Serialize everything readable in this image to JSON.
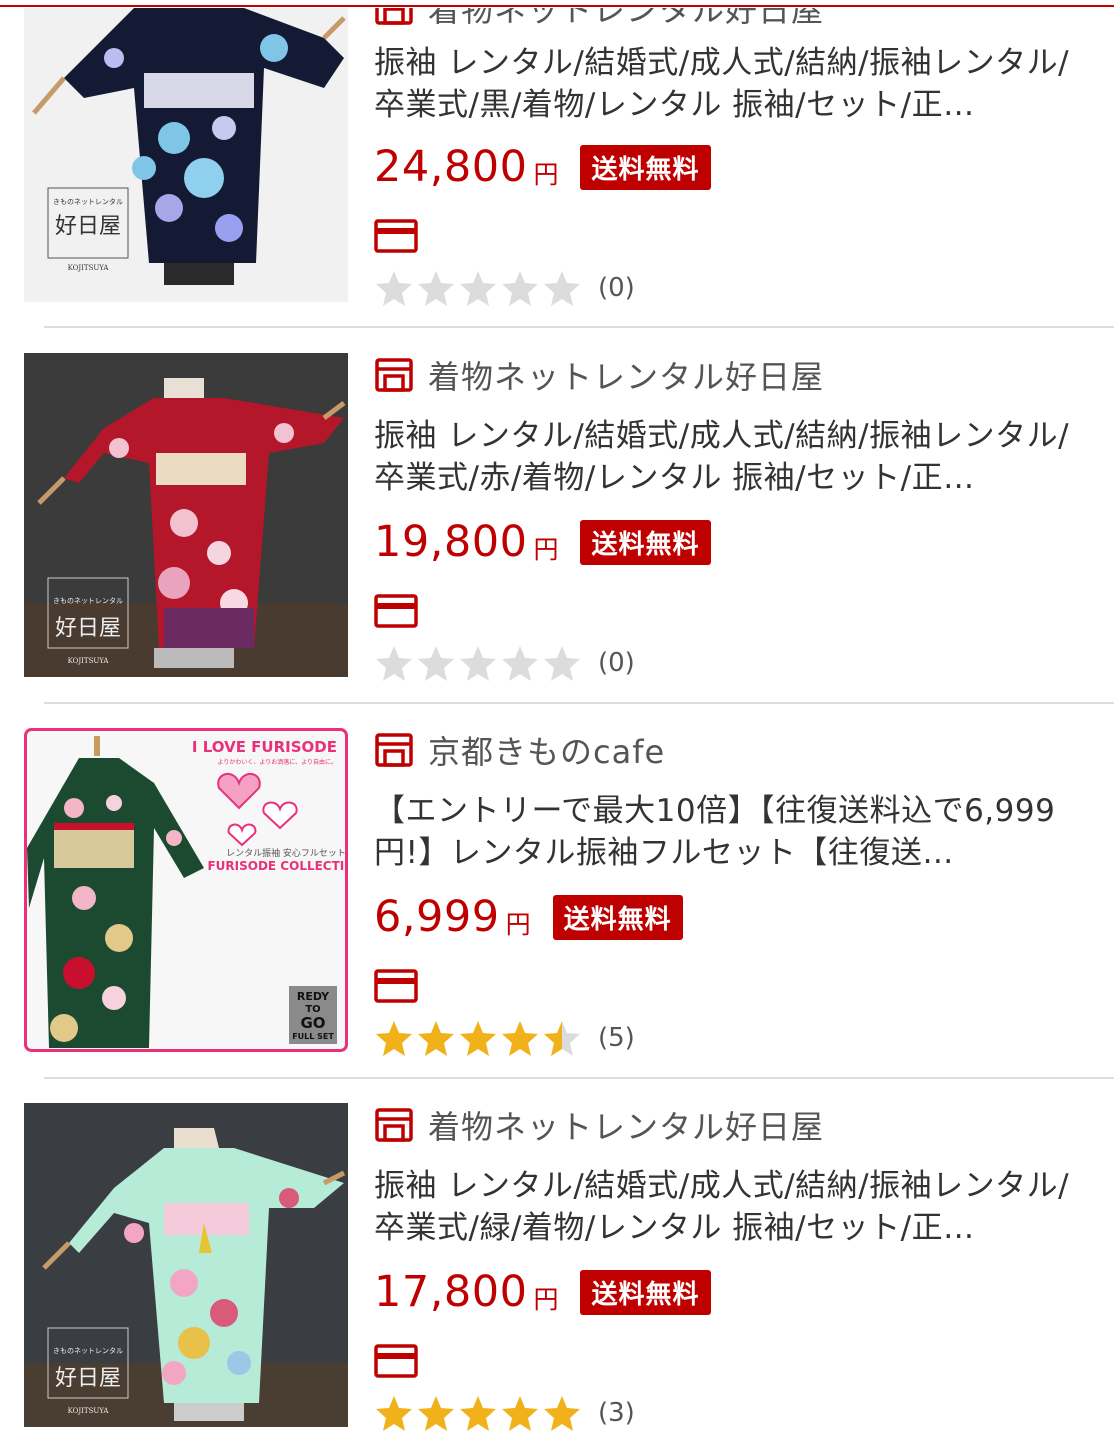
{
  "colors": {
    "accent": "#bf0000",
    "star_on": "#f0b11a",
    "star_off": "#dcdcdc"
  },
  "items": [
    {
      "shop": "着物ネットレンタル好日屋",
      "title": "振袖 レンタル/結婚式/成人式/結納/振袖レンタル/卒業式/黒/着物/レンタル 振袖/セット/正…",
      "price": "24,800",
      "yen": "円",
      "badge": "送料無料",
      "rating": 0,
      "review_count": "(0)",
      "thumb_brand_small": "きものネットレンタル",
      "thumb_brand": "好日屋",
      "thumb_brand_en": "KOJITSUYA",
      "icons": {
        "shop": "shop-icon",
        "card": "credit-card-icon"
      }
    },
    {
      "shop": "着物ネットレンタル好日屋",
      "title": "振袖 レンタル/結婚式/成人式/結納/振袖レンタル/卒業式/赤/着物/レンタル 振袖/セット/正…",
      "price": "19,800",
      "yen": "円",
      "badge": "送料無料",
      "rating": 0,
      "review_count": "(0)",
      "thumb_brand_small": "きものネットレンタル",
      "thumb_brand": "好日屋",
      "thumb_brand_en": "KOJITSUYA",
      "icons": {
        "shop": "shop-icon",
        "card": "credit-card-icon"
      }
    },
    {
      "shop": "京都きものcafe",
      "title": "【エントリーで最大10倍】【往復送料込で6,999円!】レンタル振袖フルセット【往復送…",
      "price": "6,999",
      "yen": "円",
      "badge": "送料無料",
      "rating": 4.5,
      "review_count": "(5)",
      "thumb_heading": "I LOVE FURISODE",
      "thumb_sub": "よりかわいく、よりお洒落に、より自由に。",
      "thumb_caption_jp": "レンタル振袖 安心フルセット",
      "thumb_caption_en": "FURISODE COLLECTION",
      "thumb_ready": [
        "REDY",
        "TO",
        "GO",
        "FULL SET"
      ],
      "icons": {
        "shop": "shop-icon",
        "card": "credit-card-icon"
      }
    },
    {
      "shop": "着物ネットレンタル好日屋",
      "title": "振袖 レンタル/結婚式/成人式/結納/振袖レンタル/卒業式/緑/着物/レンタル 振袖/セット/正…",
      "price": "17,800",
      "yen": "円",
      "badge": "送料無料",
      "rating": 5,
      "review_count": "(3)",
      "thumb_brand_small": "きものネットレンタル",
      "thumb_brand": "好日屋",
      "thumb_brand_en": "KOJITSUYA",
      "icons": {
        "shop": "shop-icon",
        "card": "credit-card-icon"
      }
    }
  ]
}
